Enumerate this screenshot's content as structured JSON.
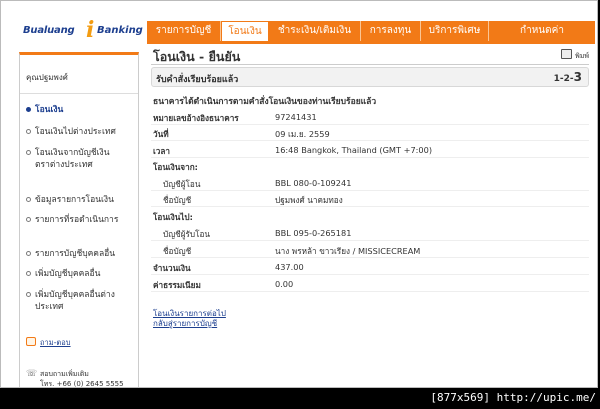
{
  "logo": {
    "brand": "Bualuang",
    "banking": "Banking"
  },
  "nav": {
    "items": [
      {
        "label": "รายการบัญชี"
      },
      {
        "label": "โอนเงิน"
      },
      {
        "label": "ชำระเงิน/เติมเงิน"
      },
      {
        "label": "การลงทุน"
      },
      {
        "label": "บริการพิเศษ"
      },
      {
        "label": "กำหนดค่า"
      }
    ],
    "active_index": 1
  },
  "sidebar": {
    "user_name": "คุณปฐมพงศ์",
    "items": [
      {
        "label": "โอนเงิน",
        "active": true
      },
      {
        "label": "โอนเงินไปต่างประเทศ"
      },
      {
        "label": "โอนเงินจากบัญชีเงินตราต่างประเทศ"
      },
      {
        "label": "ข้อมูลรายการโอนเงิน"
      },
      {
        "label": "รายการที่รอดำเนินการ"
      },
      {
        "label": "รายการบัญชีบุคคลอื่น"
      },
      {
        "label": "เพิ่มบัญชีบุคคลอื่น"
      },
      {
        "label": "เพิ่มบัญชีบุคคลอื่นต่างประเทศ"
      }
    ],
    "help_label": "ถาม-ตอบ",
    "contact_line1": "สอบถามเพิ่มเติม",
    "contact_line2": "โทร. +66 (0) 2645 5555"
  },
  "main": {
    "title": "โอนเงิน - ยืนยัน",
    "print_label": "พิมพ์",
    "status": "รับคำสั่งเรียบร้อยแล้ว",
    "steps_prefix": "1-2-",
    "steps_current": "3",
    "confirm_message": "ธนาคารได้ดำเนินการตามคำสั่งโอนเงินของท่านเรียบร้อยแล้ว",
    "details": {
      "ref_label": "หมายเลขอ้างอิงธนาคาร",
      "ref_value": "97241431",
      "date_label": "วันที่",
      "date_value": "09 เม.ย. 2559",
      "time_label": "เวลา",
      "time_value": "16:48 Bangkok, Thailand (GMT +7:00)",
      "from_header": "โอนเงินจาก:",
      "from_acct_label": "บัญชีผู้โอน",
      "from_acct_value": "BBL 080-0-109241",
      "from_name_label": "ชื่อบัญชี",
      "from_name_value": "ปฐมพงศ์ นาคมทอง",
      "to_header": "โอนเงินไป:",
      "to_acct_label": "บัญชีผู้รับโอน",
      "to_acct_value": "BBL 095-0-265181",
      "to_name_label": "ชื่อบัญชี",
      "to_name_value": "นาง พรหล้า ขาวเรียง / MISSICECREAM",
      "amount_label": "จำนวนเงิน",
      "amount_value": "437.00",
      "fee_label": "ค่าธรรมเนียม",
      "fee_value": "0.00"
    },
    "link_next_transfer": "โอนเงินรายการต่อไป",
    "link_back_accounts": "กลับสู่รายการบัญชี"
  },
  "watermark": "[877x569] http://upic.me/"
}
